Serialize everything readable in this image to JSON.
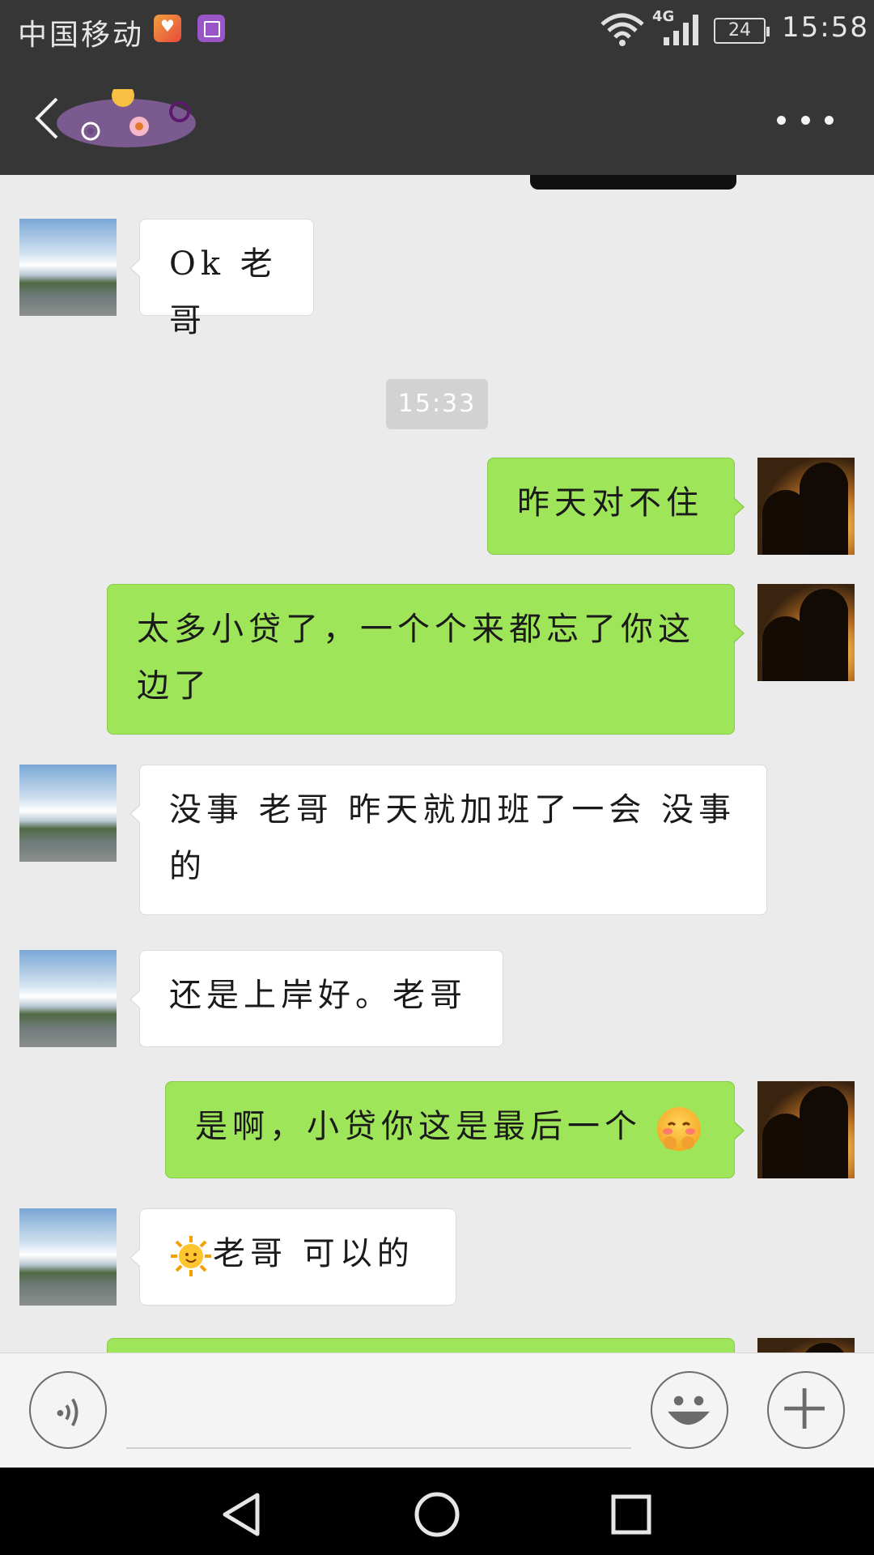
{
  "status_bar": {
    "carrier": "中国移动",
    "network": "4G",
    "battery": "24",
    "time": "15:58"
  },
  "header": {
    "back_icon": "chevron-left-icon",
    "more_icon": "more-dots-icon"
  },
  "messages": [
    {
      "side": "left",
      "text": "Ok 老哥"
    },
    {
      "type": "timestamp",
      "text": "15:33"
    },
    {
      "side": "right",
      "text": "昨天对不住"
    },
    {
      "side": "right",
      "text": "太多小贷了，一个个来都忘了你这边了"
    },
    {
      "side": "left",
      "text": "没事  老哥  昨天就加班了一会  没事的"
    },
    {
      "side": "left",
      "text": "还是上岸好。老哥"
    },
    {
      "side": "right",
      "text": "是啊，小贷你这是最后一个",
      "emoji": "blush-emoji"
    },
    {
      "side": "left",
      "text": "老哥  可以的",
      "emoji": "sun-emoji"
    }
  ],
  "input_bar": {
    "voice_icon": "voice-icon",
    "emoji_icon": "smiley-icon",
    "plus_icon": "plus-icon"
  },
  "nav_bar": {
    "back": "nav-back-icon",
    "home": "nav-home-icon",
    "recents": "nav-recents-icon"
  }
}
